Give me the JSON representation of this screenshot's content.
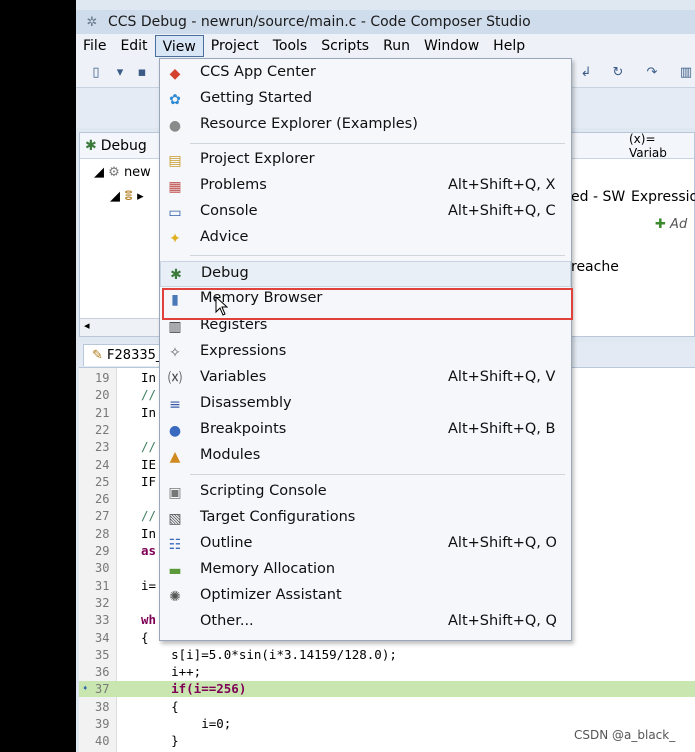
{
  "window": {
    "title": "CCS Debug - newrun/source/main.c - Code Composer Studio"
  },
  "menubar": [
    "File",
    "Edit",
    "View",
    "Project",
    "Tools",
    "Scripts",
    "Run",
    "Window",
    "Help"
  ],
  "debug_view": {
    "tab_label": "Debug",
    "tree": [
      "new",
      "▸"
    ]
  },
  "right_view": {
    "tab_label": "(x)= Variab",
    "column": "Expressio",
    "add_label": "Ad",
    "fragment1": "ed - SW",
    "fragment2": "reache"
  },
  "editor": {
    "tab_label": "F28335_",
    "lines": [
      {
        "n": "19",
        "text": "In",
        "style": "plain"
      },
      {
        "n": "20",
        "text": "//",
        "style": "cm"
      },
      {
        "n": "21",
        "text": "In",
        "style": "plain"
      },
      {
        "n": "22",
        "text": "",
        "style": "plain"
      },
      {
        "n": "23",
        "text": "//",
        "style": "cm"
      },
      {
        "n": "24",
        "text": "IE",
        "style": "plain"
      },
      {
        "n": "25",
        "text": "IF",
        "style": "plain"
      },
      {
        "n": "26",
        "text": "",
        "style": "plain"
      },
      {
        "n": "27",
        "text": "//",
        "style": "cm"
      },
      {
        "n": "28",
        "text": "In",
        "style": "plain"
      },
      {
        "n": "29",
        "text": "as",
        "style": "kw"
      },
      {
        "n": "30",
        "text": "",
        "style": "plain"
      },
      {
        "n": "31",
        "text": "i=",
        "style": "plain"
      },
      {
        "n": "32",
        "text": "",
        "style": "plain"
      },
      {
        "n": "33",
        "text": "wh",
        "style": "kw"
      },
      {
        "n": "34",
        "text": "{",
        "style": "plain"
      },
      {
        "n": "35",
        "text": "    s[i]=5.0*sin(i*3.14159/128.0);",
        "style": "plain"
      },
      {
        "n": "36",
        "text": "    i++;",
        "style": "plain"
      },
      {
        "n": "37",
        "text": "    if(i==256)",
        "style": "kw"
      },
      {
        "n": "38",
        "text": "    {",
        "style": "plain"
      },
      {
        "n": "39",
        "text": "        i=0;",
        "style": "plain"
      },
      {
        "n": "40",
        "text": "    }",
        "style": "plain"
      }
    ]
  },
  "view_menu": {
    "items": [
      {
        "label": "CCS App Center",
        "shortcut": "",
        "icon": "app-center-icon"
      },
      {
        "label": "Getting Started",
        "shortcut": "",
        "icon": "getting-started-icon"
      },
      {
        "label": "Resource Explorer (Examples)",
        "shortcut": "",
        "icon": "resource-explorer-icon"
      },
      {
        "label": "Project Explorer",
        "shortcut": "",
        "icon": "project-explorer-icon"
      },
      {
        "label": "Problems",
        "shortcut": "Alt+Shift+Q, X",
        "icon": "problems-icon"
      },
      {
        "label": "Console",
        "shortcut": "Alt+Shift+Q, C",
        "icon": "console-icon"
      },
      {
        "label": "Advice",
        "shortcut": "",
        "icon": "advice-icon"
      },
      {
        "label": "Debug",
        "shortcut": "",
        "icon": "debug-icon"
      },
      {
        "label": "Memory Browser",
        "shortcut": "",
        "icon": "memory-browser-icon"
      },
      {
        "label": "Registers",
        "shortcut": "",
        "icon": "registers-icon"
      },
      {
        "label": "Expressions",
        "shortcut": "",
        "icon": "expressions-icon"
      },
      {
        "label": "Variables",
        "shortcut": "Alt+Shift+Q, V",
        "icon": "variables-icon"
      },
      {
        "label": "Disassembly",
        "shortcut": "",
        "icon": "disassembly-icon"
      },
      {
        "label": "Breakpoints",
        "shortcut": "Alt+Shift+Q, B",
        "icon": "breakpoints-icon"
      },
      {
        "label": "Modules",
        "shortcut": "",
        "icon": "modules-icon"
      },
      {
        "label": "Scripting Console",
        "shortcut": "",
        "icon": "scripting-console-icon"
      },
      {
        "label": "Target Configurations",
        "shortcut": "",
        "icon": "target-configurations-icon"
      },
      {
        "label": "Outline",
        "shortcut": "Alt+Shift+Q, O",
        "icon": "outline-icon"
      },
      {
        "label": "Memory Allocation",
        "shortcut": "",
        "icon": "memory-allocation-icon"
      },
      {
        "label": "Optimizer Assistant",
        "shortcut": "",
        "icon": "optimizer-assistant-icon"
      },
      {
        "label": "Other...",
        "shortcut": "Alt+Shift+Q, Q",
        "icon": ""
      }
    ]
  },
  "watermark": "CSDN @a_black_"
}
